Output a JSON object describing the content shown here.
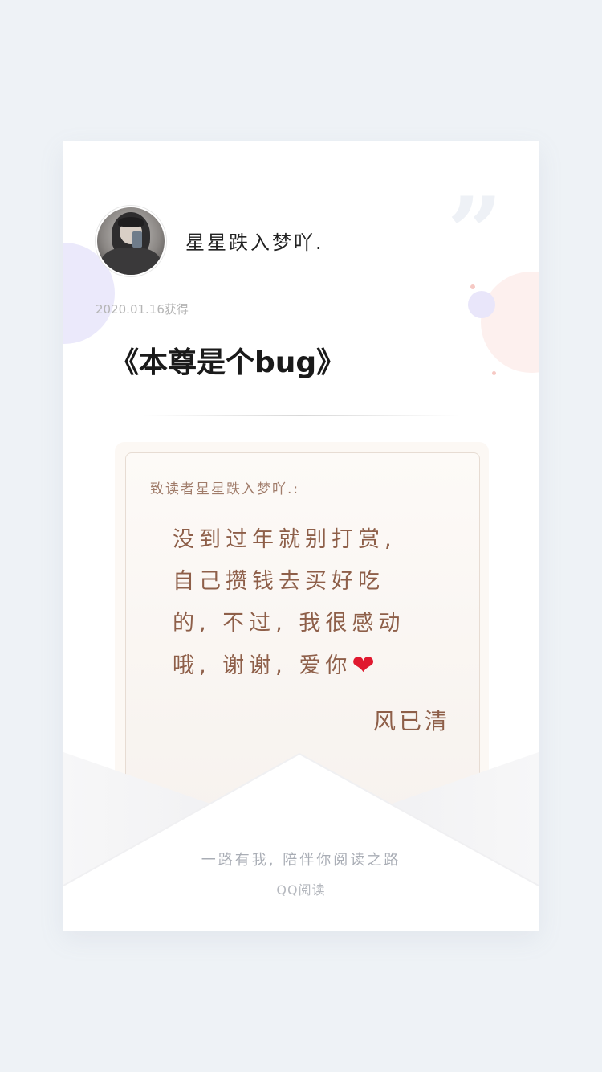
{
  "card": {
    "username": "星星跌入梦吖.",
    "date_label": "2020.01.16获得",
    "book_title": "《本尊是个bug》"
  },
  "letter": {
    "salutation": "致读者星星跌入梦吖.:",
    "lines": [
      "没到过年就别打赏,",
      "自己攒钱去买好吃",
      "的, 不过, 我很感动",
      "哦, 谢谢, 爱你"
    ],
    "heart": "❤",
    "signature": "风已清"
  },
  "footer": {
    "tagline": "一路有我, 陪伴你阅读之路",
    "brand": "QQ阅读"
  },
  "icons": {
    "quote": "quote-icon",
    "heart": "heart-icon",
    "avatar": "avatar"
  },
  "colors": {
    "page_bg": "#eef2f6",
    "card_bg": "#ffffff",
    "letter_text": "#8e5f49",
    "heart": "#e0192f"
  }
}
